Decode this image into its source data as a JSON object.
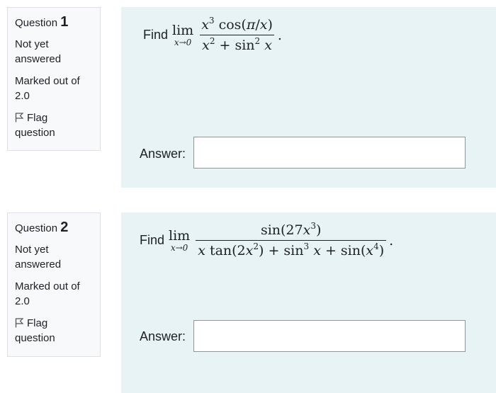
{
  "questions": [
    {
      "label": "Question",
      "number": "1",
      "status": [
        "Not yet",
        "answered"
      ],
      "marks": [
        "Marked out of",
        "2.0"
      ],
      "flag": [
        "Flag",
        "question"
      ],
      "prompt_word": "Find",
      "lim_word": "lim",
      "lim_sub": "x→0",
      "answer_label": "Answer:",
      "answer_value": ""
    },
    {
      "label": "Question",
      "number": "2",
      "status": [
        "Not yet",
        "answered"
      ],
      "marks": [
        "Marked out of",
        "2.0"
      ],
      "flag": [
        "Flag",
        "question"
      ],
      "prompt_word": "Find",
      "lim_word": "lim",
      "lim_sub": "x→0",
      "answer_label": "Answer:",
      "answer_value": ""
    }
  ],
  "icons": {
    "flag": "flag-outline-icon"
  },
  "colors": {
    "content_bg": "#e7f3f5",
    "info_bg": "#f8f9fa"
  }
}
